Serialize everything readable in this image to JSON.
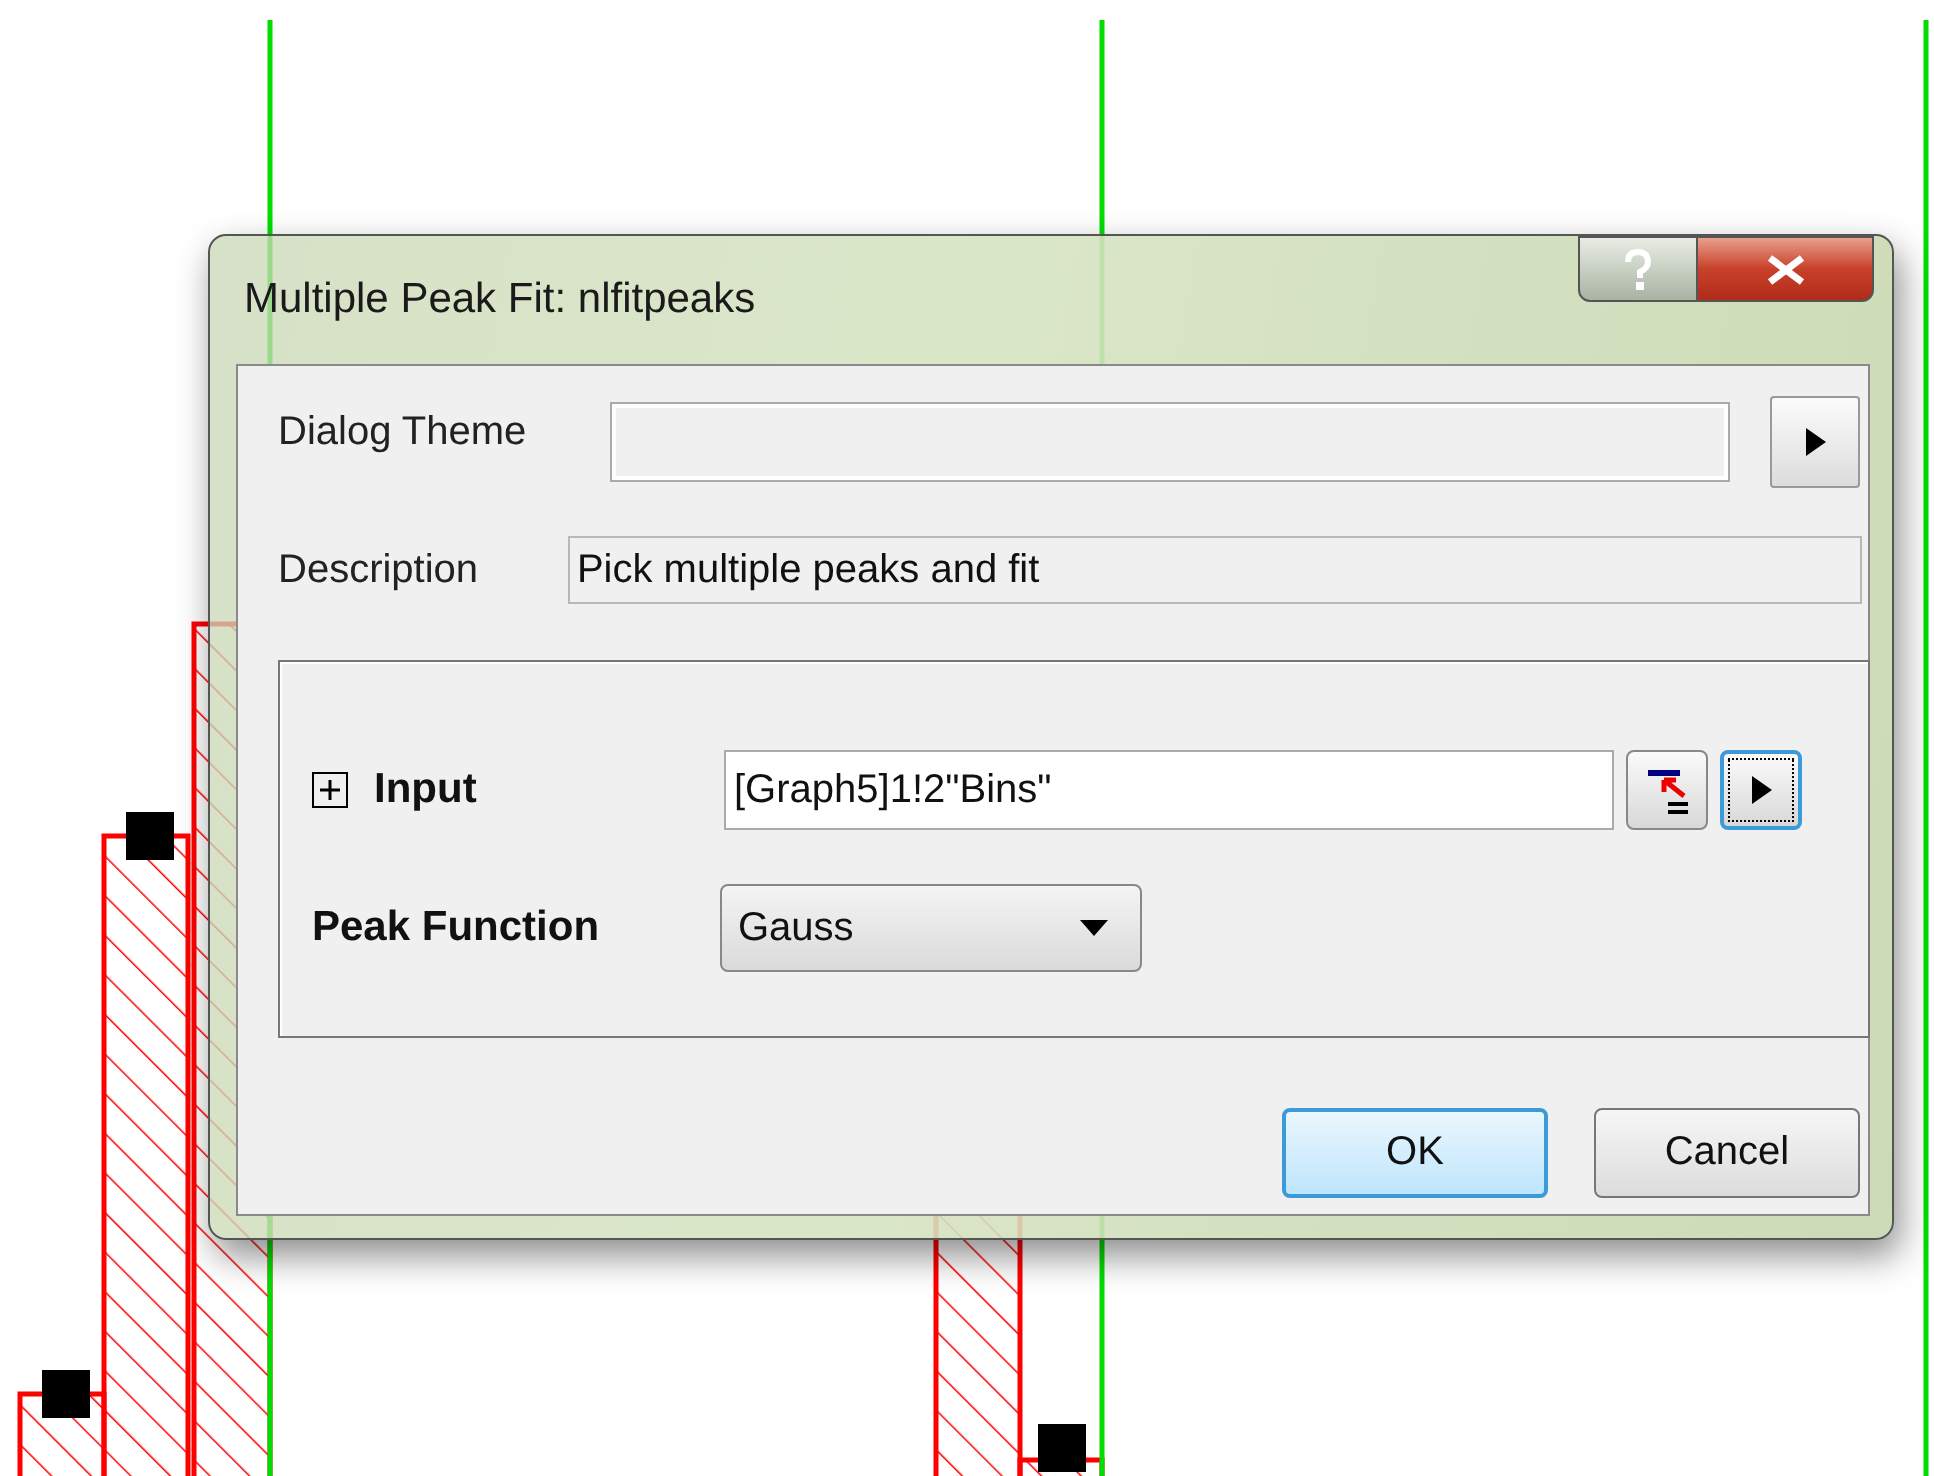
{
  "window": {
    "title": "Multiple Peak Fit: nlfitpeaks"
  },
  "dialog_theme": {
    "label": "Dialog Theme"
  },
  "description": {
    "label": "Description",
    "value": "Pick multiple peaks and fit"
  },
  "input": {
    "label": "Input",
    "expanded": false,
    "value": "[Graph5]1!2\"Bins\""
  },
  "peak_function": {
    "label": "Peak Function",
    "value": "Gauss"
  },
  "buttons": [
    {
      "label": "OK",
      "default": true
    },
    {
      "label": "Cancel",
      "default": false
    }
  ]
}
